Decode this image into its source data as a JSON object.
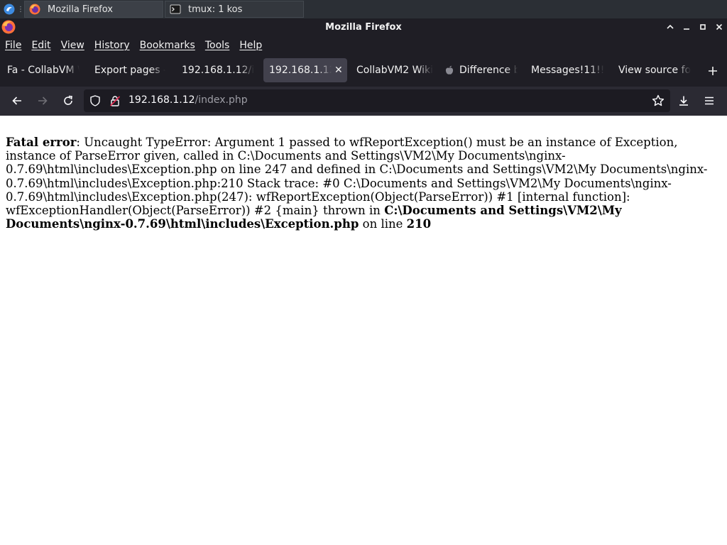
{
  "taskbar": {
    "tasks": [
      {
        "label": "Mozilla Firefox",
        "icon": "firefox-icon"
      },
      {
        "label": "tmux: 1 kos",
        "icon": "terminal-icon"
      }
    ]
  },
  "window": {
    "title": "Mozilla Firefox"
  },
  "menu": {
    "items": [
      "File",
      "Edit",
      "View",
      "History",
      "Bookmarks",
      "Tools",
      "Help"
    ]
  },
  "tabs": [
    {
      "label": "Fa - CollabVM W"
    },
    {
      "label": "Export pages -"
    },
    {
      "label": "192.168.1.12/i"
    },
    {
      "label": "192.168.1.12",
      "selected": true
    },
    {
      "label": "CollabVM2 Wiki"
    },
    {
      "label": "Difference b",
      "icon": "apple-icon"
    },
    {
      "label": "Messages!11!!"
    },
    {
      "label": "View source fo"
    }
  ],
  "urlbar": {
    "host": "192.168.1.12",
    "path": "/index.php"
  },
  "page": {
    "fatal_label": "Fatal error",
    "message": ": Uncaught TypeError: Argument 1 passed to wfReportException() must be an instance of Exception, instance of ParseError given, called in C:\\Documents and Settings\\VM2\\My Documents\\nginx-0.7.69\\html\\includes\\Exception.php on line 247 and defined in C:\\Documents and Settings\\VM2\\My Documents\\nginx-0.7.69\\html\\includes\\Exception.php:210 Stack trace: #0 C:\\Documents and Settings\\VM2\\My Documents\\nginx-0.7.69\\html\\includes\\Exception.php(247): wfReportException(Object(ParseError)) #1 [internal function]: wfExceptionHandler(Object(ParseError)) #2 {main} thrown in ",
    "file_path": "C:\\Documents and Settings\\VM2\\My Documents\\nginx-0.7.69\\html\\includes\\Exception.php",
    "on_line_text": " on line ",
    "line_number": "210"
  },
  "colors": {
    "chrome_dark": "#1f1e25",
    "toolbar": "#2b2a33",
    "urlbar_bg": "#1c1b22",
    "selected_tab": "#42414d",
    "firefox_orange": "#ff7139"
  }
}
